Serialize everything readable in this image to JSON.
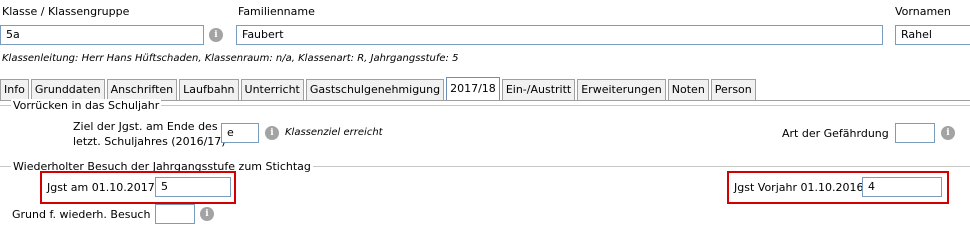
{
  "header": {
    "klasse_label": "Klasse / Klassengruppe",
    "klasse_value": "5a",
    "familienname_label": "Familienname",
    "familienname_value": "Faubert",
    "vorname_label": "Vornamen",
    "vorname_value": "Rahel",
    "info_text": "Klassenleitung: Herr Hans Hüftschaden, Klassenraum: n/a, Klassenart: R, Jahrgangsstufe: 5"
  },
  "tabs": [
    {
      "label": "Info"
    },
    {
      "label": "Grunddaten"
    },
    {
      "label": "Anschriften"
    },
    {
      "label": "Laufbahn"
    },
    {
      "label": "Unterricht"
    },
    {
      "label": "Gastschulgenehmigung"
    },
    {
      "label": "2017/18",
      "active": true
    },
    {
      "label": "Ein-/Austritt"
    },
    {
      "label": "Erweiterungen"
    },
    {
      "label": "Noten"
    },
    {
      "label": "Person"
    }
  ],
  "section1": {
    "title": "Vorrücken in das Schuljahr",
    "ziel_label_line1": "Ziel der Jgst. am Ende des",
    "ziel_label_line2": "letzt. Schuljahres (2016/17)",
    "ziel_value": "e",
    "ziel_note": "Klassenziel erreicht",
    "gefaehrdung_label": "Art der Gefährdung",
    "gefaehrdung_value": ""
  },
  "section2": {
    "title": "Wiederholter Besuch der Jahrgangsstufe zum Stichtag",
    "jgst_label": "Jgst am 01.10.2017",
    "jgst_value": "5",
    "jgst_vorjahr_label": "Jgst Vorjahr 01.10.2016",
    "jgst_vorjahr_value": "4",
    "grund_label": "Grund f. wiederh. Besuch",
    "grund_value": ""
  },
  "icons": {
    "info": "info-icon",
    "info_glyph": "i"
  },
  "colors": {
    "highlight": "#d40000",
    "input_border": "#7a9cbf",
    "info_icon": "#a3a3a3"
  }
}
